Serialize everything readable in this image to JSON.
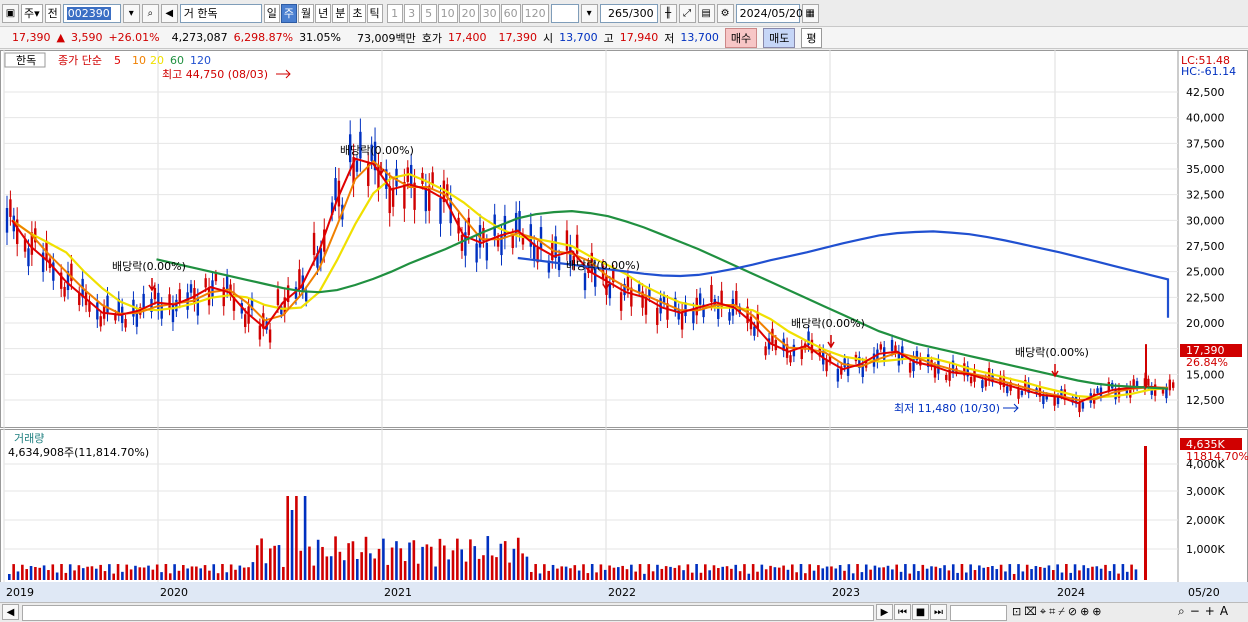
{
  "toolbar": {
    "market_sel": "주",
    "prev_label": "전",
    "code": "002390",
    "stock_name": "거 한독",
    "periods": [
      {
        "label": "일",
        "selected": false
      },
      {
        "label": "주",
        "selected": true
      },
      {
        "label": "월",
        "selected": false
      },
      {
        "label": "년",
        "selected": false
      },
      {
        "label": "분",
        "selected": false
      },
      {
        "label": "초",
        "selected": false
      },
      {
        "label": "틱",
        "selected": false
      }
    ],
    "intervals": [
      "1",
      "3",
      "5",
      "10",
      "20",
      "30",
      "60",
      "120"
    ],
    "count": "265",
    "count_total": "/300",
    "date": "2024/05/20"
  },
  "quote": {
    "price": "17,390",
    "change": "3,590",
    "change_pct": "+26.01%",
    "volume": "4,273,087",
    "volume_pct": "6,298.87%",
    "turnover": "31.05%",
    "amount": "73,009백만",
    "ask_label": "호가",
    "ask": "17,400",
    "bid": "17,390",
    "open_label": "시",
    "open": "13,700",
    "high_label": "고",
    "high": "17,940",
    "low_label": "저",
    "low": "13,700",
    "buy_label": "매수",
    "sell_label": "매도",
    "avg_label": "평"
  },
  "price_panel": {
    "name": "한독",
    "ma_label": "종가 단순",
    "ma_periods": [
      "5",
      "10",
      "20",
      "60",
      "120"
    ],
    "high_text": "최고 44,750 (08/03)",
    "low_text": "최저 11,480 (10/30)",
    "lc": "LC:51.48",
    "hc": "HC:-61.14",
    "current_price": "17,390",
    "current_pct": "26.84%",
    "dividend_label": "배당락(0.00%)",
    "y_ticks": [
      "42,500",
      "40,000",
      "37,500",
      "35,000",
      "32,500",
      "30,000",
      "27,500",
      "25,000",
      "22,500",
      "20,000",
      "17,500",
      "15,000",
      "12,500"
    ]
  },
  "volume_panel": {
    "title": "거래량",
    "value_text": "4,634,908주(11,814.70%)",
    "current": "4,635K",
    "current_pct": "11814.70%",
    "y_ticks": [
      "4,000K",
      "3,000K",
      "2,000K",
      "1,000K"
    ]
  },
  "x_axis": {
    "labels": [
      "2019",
      "2020",
      "2021",
      "2022",
      "2023",
      "2024",
      "05/20"
    ]
  },
  "colors": {
    "up": "#d00000",
    "down": "#0030c0",
    "ma5": "#e00000",
    "ma10": "#f08000",
    "ma20": "#f0e000",
    "ma60": "#209040",
    "ma120": "#2050d0"
  },
  "chart_data": {
    "type": "line",
    "title": "한독",
    "xlabel": "",
    "ylabel": "",
    "x": [
      "2019-01",
      "2019-02",
      "2019-03",
      "2019-04",
      "2019-05",
      "2019-06",
      "2019-07",
      "2019-08",
      "2019-09",
      "2019-10",
      "2019-11",
      "2019-12",
      "2020-01",
      "2020-02",
      "2020-03",
      "2020-04",
      "2020-05",
      "2020-06",
      "2020-07",
      "2020-08",
      "2020-09",
      "2020-10",
      "2020-11",
      "2020-12",
      "2021-01",
      "2021-02",
      "2021-03",
      "2021-04",
      "2021-05",
      "2021-06",
      "2021-07",
      "2021-08",
      "2021-09",
      "2021-10",
      "2021-11",
      "2021-12",
      "2022-01",
      "2022-02",
      "2022-03",
      "2022-04",
      "2022-05",
      "2022-06",
      "2022-07",
      "2022-08",
      "2022-09",
      "2022-10",
      "2022-11",
      "2022-12",
      "2023-01",
      "2023-02",
      "2023-03",
      "2023-04",
      "2023-05",
      "2023-06",
      "2023-07",
      "2023-08",
      "2023-09",
      "2023-10",
      "2023-11",
      "2023-12",
      "2024-01",
      "2024-02",
      "2024-03",
      "2024-04",
      "2024-05"
    ],
    "series": [
      {
        "name": "5",
        "values": [
          30000,
          27500,
          26000,
          24000,
          22500,
          21000,
          20800,
          21200,
          22000,
          21800,
          22500,
          23500,
          23000,
          21000,
          19500,
          22000,
          23500,
          27000,
          32000,
          36000,
          35500,
          33000,
          33500,
          33000,
          32000,
          28500,
          27800,
          28500,
          29000,
          27500,
          26500,
          27000,
          25000,
          24000,
          23000,
          22500,
          21500,
          21000,
          21500,
          22000,
          21500,
          20000,
          18000,
          17200,
          17800,
          16500,
          15500,
          16000,
          17000,
          17200,
          16200,
          15800,
          15200,
          15000,
          14500,
          14000,
          13500,
          13000,
          12800,
          12200,
          13000,
          13500,
          13700,
          13800,
          13600
        ]
      },
      {
        "name": "60",
        "values": [
          26200,
          25800,
          25400,
          25000,
          24600,
          24200,
          23800,
          23400,
          23100,
          23000,
          23200,
          23700,
          24300,
          25000,
          25800,
          26500,
          27200,
          28000,
          28800,
          29500,
          30200,
          30600,
          30800,
          30900,
          30700,
          30400,
          29900,
          29300,
          28600,
          27900,
          27200,
          26400,
          25600,
          24800,
          24000,
          23200,
          22400,
          21600,
          20800,
          20000,
          19200,
          18600,
          18000,
          17600,
          17200,
          16800,
          16400,
          16000,
          15600,
          15200,
          14800,
          14400,
          14100,
          13900,
          13800,
          13700,
          13600
        ]
      }
    ],
    "ylim": [
      10000,
      45000
    ],
    "volume_last": "4,634,908"
  }
}
